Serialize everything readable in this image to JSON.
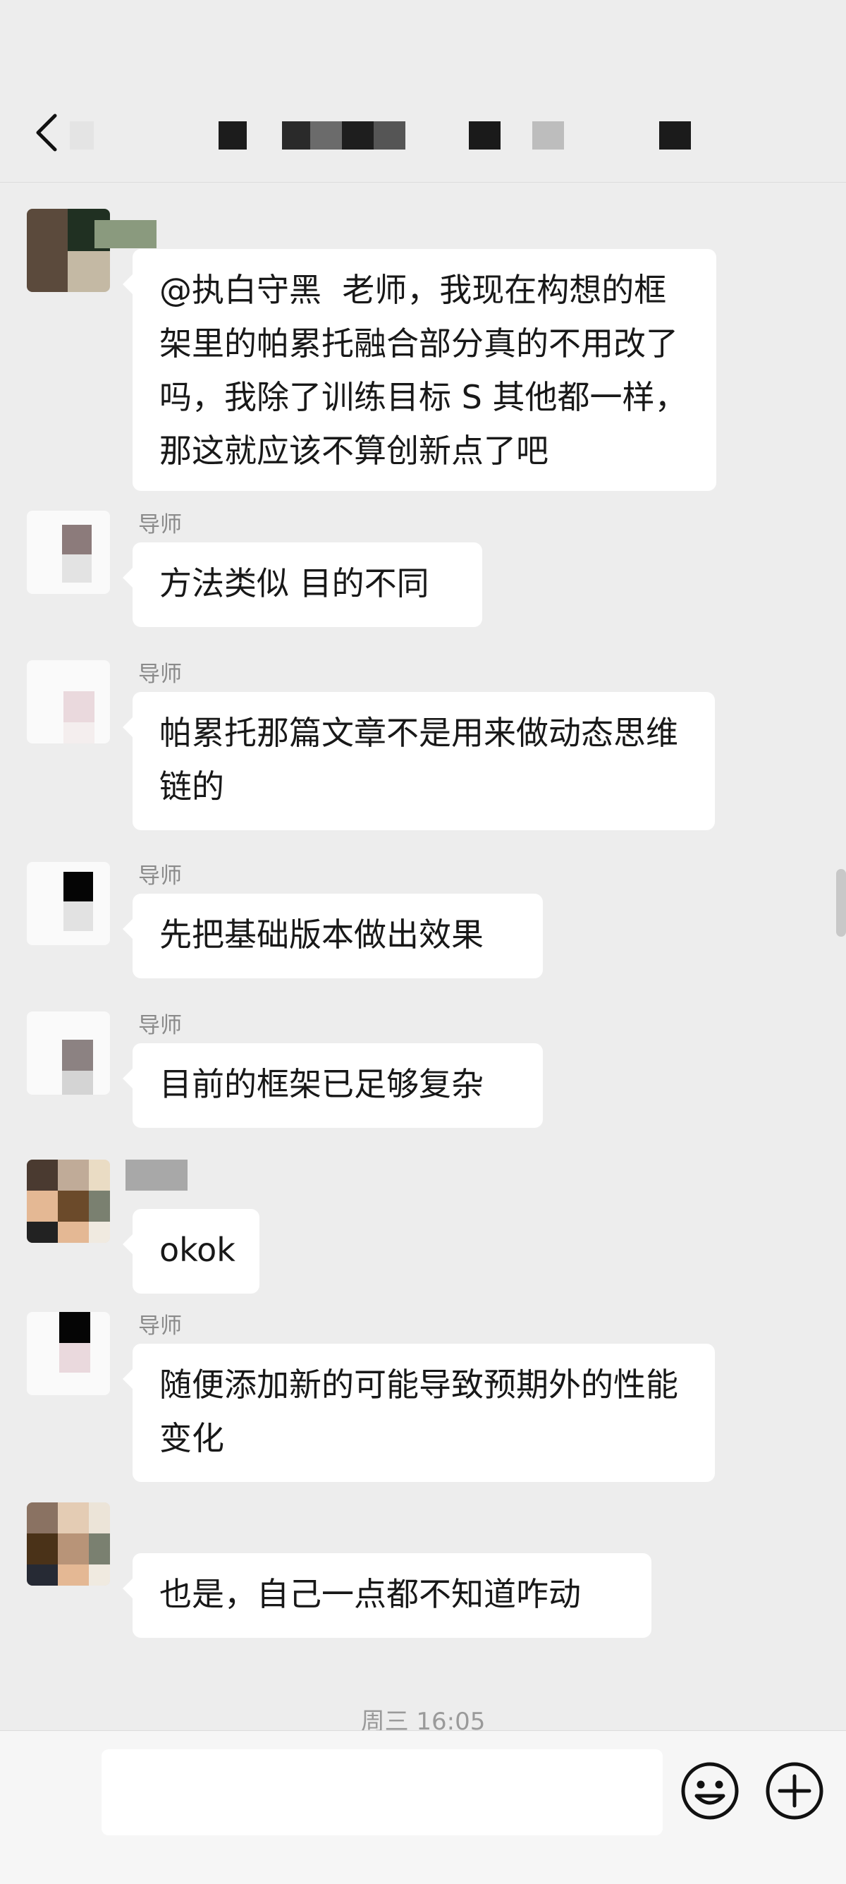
{
  "header": {
    "title": "",
    "back_icon": "chevron-left-icon"
  },
  "messages": [
    {
      "sender": "",
      "text": "@执白守黑  老师，我现在构想的框架里的帕累托融合部分真的不用改了吗，我除了训练目标 S 其他都一样，那这就应该不算创新点了吧"
    },
    {
      "sender": "导师",
      "text": "方法类似 目的不同"
    },
    {
      "sender": "导师",
      "text": "帕累托那篇文章不是用来做动态思维链的"
    },
    {
      "sender": "导师",
      "text": "先把基础版本做出效果"
    },
    {
      "sender": "导师",
      "text": "目前的框架已足够复杂"
    },
    {
      "sender": "",
      "text": "okok"
    },
    {
      "sender": "导师",
      "text": "随便添加新的可能导致预期外的性能变化"
    },
    {
      "sender": "",
      "text": "也是，自己一点都不知道咋动"
    }
  ],
  "timestamp": "周三 16:05",
  "input": {
    "placeholder": "",
    "value": "",
    "emoji_icon": "emoji-icon",
    "plus_icon": "plus-icon"
  },
  "colors": {
    "background": "#ededed",
    "bubble": "#ffffff",
    "sender_name": "#8a8a8a",
    "timestamp": "#9a9a9a"
  }
}
